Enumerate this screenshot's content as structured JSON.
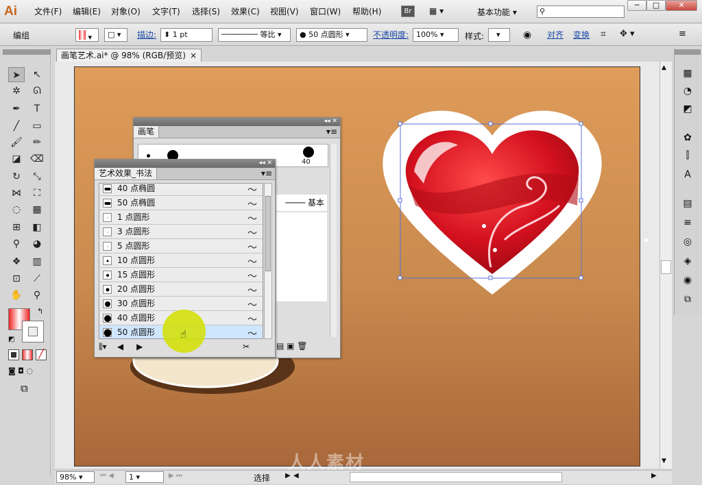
{
  "app": {
    "logo": "Ai"
  },
  "menu": [
    "文件(F)",
    "编辑(E)",
    "对象(O)",
    "文字(T)",
    "选择(S)",
    "效果(C)",
    "视图(V)",
    "窗口(W)",
    "帮助(H)"
  ],
  "bridge_label": "Br",
  "workspace": "基本功能",
  "window_controls": {
    "min": "─",
    "max": "□",
    "close": "✕"
  },
  "control": {
    "group_label": "编组",
    "stroke_label": "描边:",
    "stroke_value": "1 pt",
    "profile_label": "等比",
    "brush_value": "50 点圆形",
    "opacity_label": "不透明度:",
    "opacity_value": "100%",
    "style_label": "样式:",
    "align_label": "对齐",
    "transform_label": "变换"
  },
  "document": {
    "tab_title": "画笔艺术.ai* @ 98% (RGB/预览)",
    "close": "×"
  },
  "brush_panel": {
    "title": "画笔",
    "size_label": "40",
    "basic_label": "基本"
  },
  "art_panel": {
    "title": "艺术效果_书法",
    "rows": [
      {
        "label": "40 点椭圆",
        "shape": "oval",
        "size": 40
      },
      {
        "label": "50 点椭圆",
        "shape": "oval",
        "size": 50
      },
      {
        "label": "1 点圆形",
        "shape": "round",
        "size": 1
      },
      {
        "label": "3 点圆形",
        "shape": "round",
        "size": 3
      },
      {
        "label": "5 点圆形",
        "shape": "round",
        "size": 5
      },
      {
        "label": "10 点圆形",
        "shape": "round",
        "size": 10
      },
      {
        "label": "15 点圆形",
        "shape": "round",
        "size": 15
      },
      {
        "label": "20 点圆形",
        "shape": "round",
        "size": 20
      },
      {
        "label": "30 点圆形",
        "shape": "round",
        "size": 30
      },
      {
        "label": "40 点圆形",
        "shape": "round",
        "size": 40
      },
      {
        "label": "50 点圆形",
        "shape": "round",
        "size": 50,
        "selected": true
      }
    ]
  },
  "status": {
    "zoom": "98%",
    "page": "1",
    "tool": "选择"
  },
  "watermark": "人人素材",
  "colors": {
    "artboard_top": "#df9c5a",
    "artboard_bottom": "#a9683a",
    "heart": "#c8101e",
    "highlight": "#d4e000"
  }
}
